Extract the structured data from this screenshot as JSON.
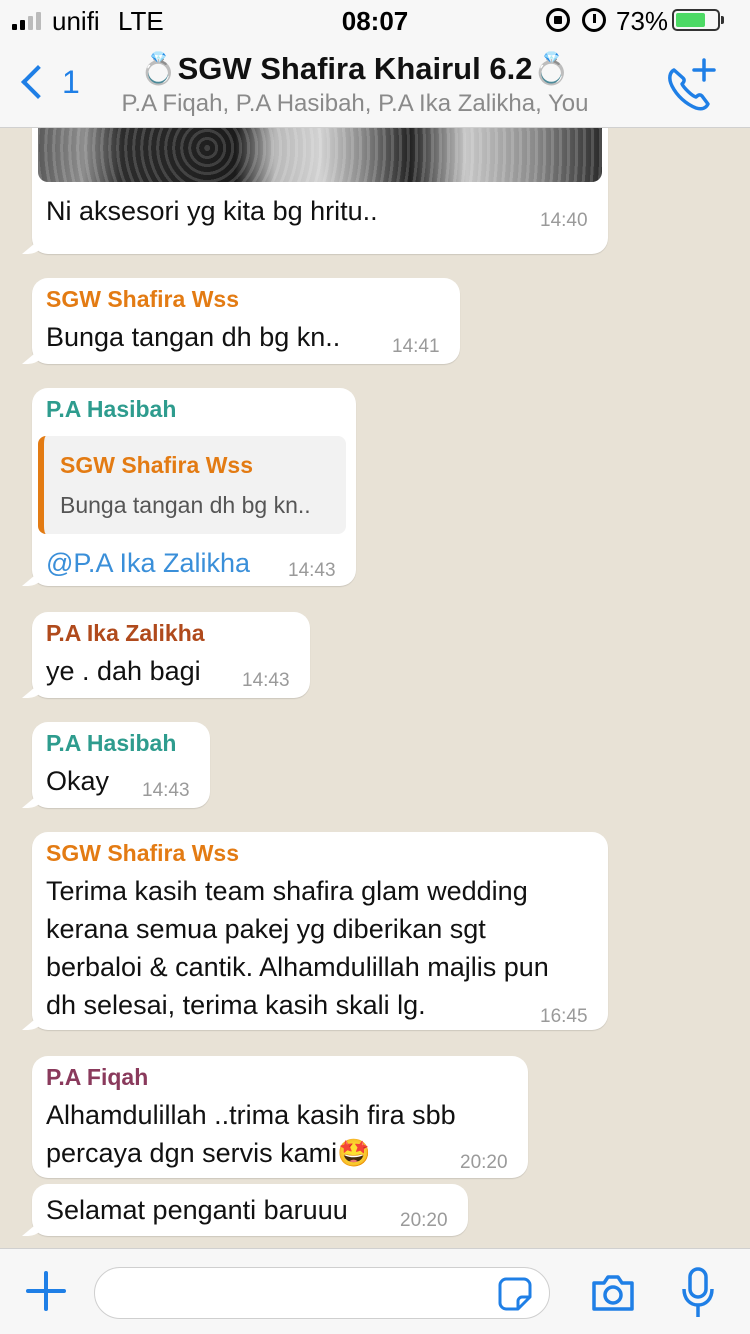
{
  "status_bar": {
    "carrier": "unifi",
    "network": "LTE",
    "time": "08:07",
    "battery": "73%"
  },
  "header": {
    "back_count": "1",
    "title": "💍SGW Shafira Khairul 6.2💍",
    "members": "P.A Fiqah, P.A Hasibah, P.A Ika Zalikha, You"
  },
  "colors": {
    "accent": "#1f7fe6",
    "sender_sgw": "#e37b13",
    "sender_hasibah": "#2e9c8e",
    "sender_ika": "#b04a1c",
    "sender_fiqah": "#8a3a5c",
    "mention": "#3a8fd9"
  },
  "messages": [
    {
      "sender": "",
      "text": "Ni aksesori yg kita bg hritu..",
      "time": "14:40"
    },
    {
      "sender": "SGW Shafira Wss",
      "text": "Bunga tangan dh bg kn..",
      "time": "14:41"
    },
    {
      "sender": "P.A Hasibah",
      "quote_sender": "SGW Shafira Wss",
      "quote_text": "Bunga tangan dh bg kn..",
      "text": "@P.A Ika Zalikha",
      "time": "14:43"
    },
    {
      "sender": "P.A Ika Zalikha",
      "text": "ye . dah bagi",
      "time": "14:43"
    },
    {
      "sender": "P.A Hasibah",
      "text": "Okay",
      "time": "14:43"
    },
    {
      "sender": "SGW Shafira Wss",
      "lines": [
        "Terima kasih team shafira glam wedding",
        "kerana semua pakej yg diberikan sgt",
        "berbaloi & cantik. Alhamdulillah majlis pun",
        "dh selesai, terima kasih skali lg."
      ],
      "time": "16:45"
    },
    {
      "sender": "P.A Fiqah",
      "lines": [
        "Alhamdulillah ..trima kasih fira sbb",
        "percaya dgn servis kami🤩"
      ],
      "time": "20:20"
    },
    {
      "sender": "",
      "text": "Selamat penganti baruuu",
      "time": "20:20"
    }
  ],
  "input": {
    "placeholder": ""
  },
  "icons": {
    "back": "chevron-left-icon",
    "call": "add-call-icon",
    "plus": "plus-icon",
    "sticker": "sticker-icon",
    "camera": "camera-icon",
    "mic": "microphone-icon"
  }
}
